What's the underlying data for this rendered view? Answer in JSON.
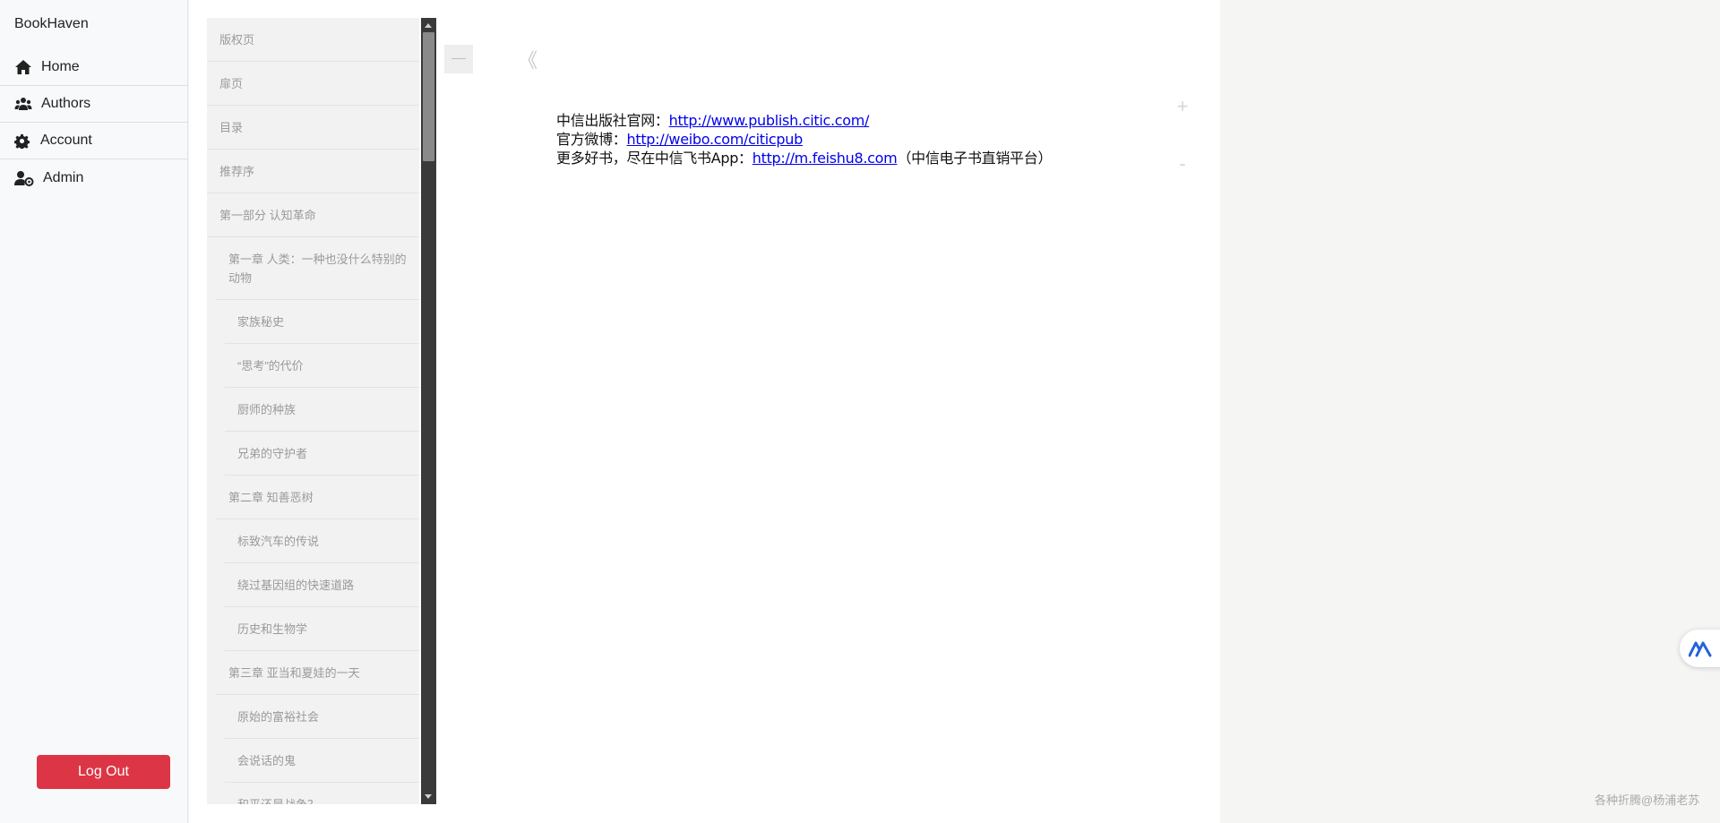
{
  "app": {
    "brand": "BookHaven"
  },
  "nav": [
    {
      "label": "Home",
      "icon": "home-icon"
    },
    {
      "label": "Authors",
      "icon": "users-icon"
    },
    {
      "label": "Account",
      "icon": "gear-icon"
    },
    {
      "label": "Admin",
      "icon": "user-gear-icon"
    }
  ],
  "logout_label": "Log Out",
  "toc": [
    {
      "label": "版权页",
      "level": 1
    },
    {
      "label": "扉页",
      "level": 1
    },
    {
      "label": "目录",
      "level": 1
    },
    {
      "label": "推荐序",
      "level": 1
    },
    {
      "label": "第一部分 认知革命",
      "level": 1
    },
    {
      "label": "第一章 人类：一种也没什么特别的动物",
      "level": 2
    },
    {
      "label": "家族秘史",
      "level": 3
    },
    {
      "label": "“思考”的代价",
      "level": 3
    },
    {
      "label": "厨师的种族",
      "level": 3
    },
    {
      "label": "兄弟的守护者",
      "level": 3
    },
    {
      "label": "第二章 知善恶树",
      "level": 2
    },
    {
      "label": "标致汽车的传说",
      "level": 3
    },
    {
      "label": "绕过基因组的快速道路",
      "level": 3
    },
    {
      "label": "历史和生物学",
      "level": 3
    },
    {
      "label": "第三章 亚当和夏娃的一天",
      "level": 2
    },
    {
      "label": "原始的富裕社会",
      "level": 3
    },
    {
      "label": "会说话的鬼",
      "level": 3
    },
    {
      "label": "和平还是战争？",
      "level": 3
    }
  ],
  "reader": {
    "prev": "《",
    "zoom_in": "+",
    "zoom_out": "-",
    "lines": [
      {
        "prefix": "中信出版社官网：",
        "link": "http://www.publish.citic.com/",
        "suffix": ""
      },
      {
        "prefix": "官方微博：",
        "link": "http://weibo.com/citicpub",
        "suffix": ""
      },
      {
        "prefix": "更多好书，尽在中信飞书App：",
        "link": "http://m.feishu8.com",
        "suffix": "（中信电子书直销平台）"
      }
    ]
  },
  "float_button_icon": "assistant-logo-icon",
  "watermark": "各种折腾@杨浦老苏",
  "colors": {
    "logout": "#dc3545",
    "link": "#0000ee"
  }
}
